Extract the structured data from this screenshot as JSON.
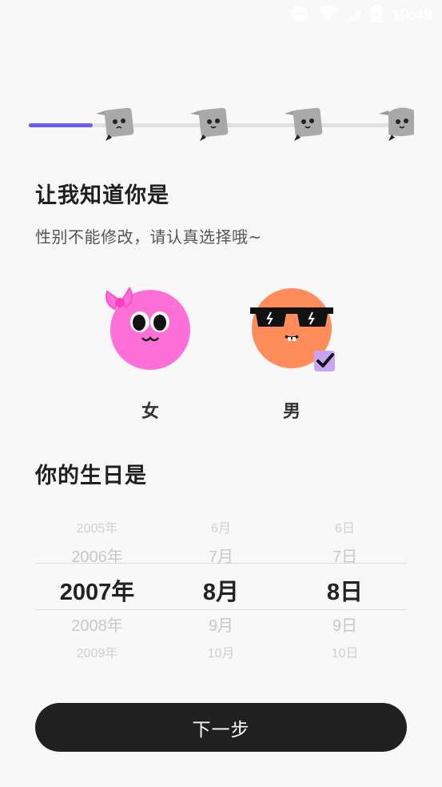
{
  "status_bar": {
    "time": "10:49",
    "icons": [
      "dnd-icon",
      "wifi-icon",
      "signal-icon",
      "battery-icon"
    ]
  },
  "progress": {
    "steps": 5,
    "current_step": 1,
    "fraction_complete": 0.17,
    "active_color": "#6a5cf0"
  },
  "title": "让我知道你是",
  "subtitle": "性别不能修改，请认真选择哦~",
  "gender": {
    "options": [
      {
        "label": "女",
        "icon": "girl-avatar-icon",
        "color": "#ff6fd8",
        "selected": false
      },
      {
        "label": "男",
        "icon": "boy-avatar-icon",
        "color": "#ff8c5a",
        "selected": true
      }
    ],
    "check_color": "#c9a4f5"
  },
  "birthday": {
    "title": "你的生日是",
    "year": {
      "items": [
        "2005年",
        "2006年",
        "2007年",
        "2008年",
        "2009年"
      ],
      "selected": "2007年"
    },
    "month": {
      "items": [
        "6月",
        "7月",
        "8月",
        "9月",
        "10月"
      ],
      "selected": "8月"
    },
    "day": {
      "items": [
        "6日",
        "7日",
        "8日",
        "9日",
        "10日"
      ],
      "selected": "8日"
    }
  },
  "next_button": "下一步"
}
